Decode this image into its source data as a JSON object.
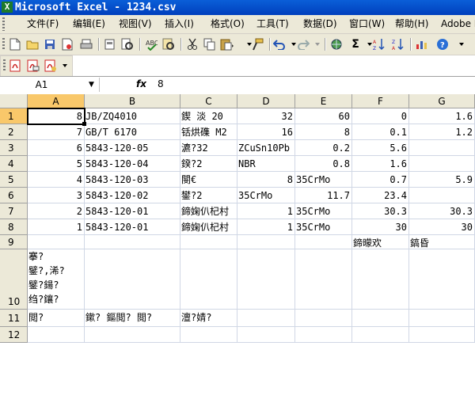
{
  "window": {
    "title": "Microsoft Excel - 1234.csv",
    "app_icon_letter": "X"
  },
  "menu": [
    "文件(F)",
    "编辑(E)",
    "视图(V)",
    "插入(I)",
    "格式(O)",
    "工具(T)",
    "数据(D)",
    "窗口(W)",
    "帮助(H)",
    "Adobe PDF"
  ],
  "toolbar": {
    "buttons": [
      "new-icon",
      "open-icon",
      "save-icon",
      "permission-icon",
      "print-icon",
      "print-preview-icon",
      "spelling-icon",
      "research-icon",
      "cut-icon",
      "copy-icon",
      "paste-icon",
      "format-painter-icon",
      "undo-icon",
      "redo-icon",
      "hyperlink-icon",
      "autosum-icon",
      "sort-ascending-icon",
      "sort-descending-icon",
      "chart-wizard-icon",
      "help-icon"
    ],
    "autosum_glyph": "Σ"
  },
  "pdf_toolbar": {
    "buttons": [
      "convert-to-pdf-icon",
      "convert-and-email-icon",
      "convert-and-review-icon"
    ]
  },
  "formula_bar": {
    "name_box": "A1",
    "fx_label": "fx",
    "value": "8"
  },
  "sheet": {
    "columns": [
      "A",
      "B",
      "C",
      "D",
      "E",
      "F",
      "G"
    ],
    "selected_column": "A",
    "selected_row": "1",
    "rows": [
      {
        "num": "1",
        "cells": [
          "8",
          "JB/ZQ4010",
          "鍥  淡  20",
          "32",
          "60",
          "0",
          "1.6"
        ]
      },
      {
        "num": "2",
        "cells": [
          "7",
          "GB/T 6170",
          "铦烘磼 M2",
          "16",
          "8",
          "0.1",
          "1.2"
        ]
      },
      {
        "num": "3",
        "cells": [
          "6",
          "5843-120-05",
          "瀌?32",
          "ZCuSn10Pb",
          "0.2",
          "5.6",
          ""
        ]
      },
      {
        "num": "4",
        "cells": [
          "5",
          "5843-120-04",
          "鍨?2",
          "NBR",
          "0.8",
          "1.6",
          ""
        ]
      },
      {
        "num": "5",
        "cells": [
          "4",
          "5843-120-03",
          "閿€",
          "8",
          "35CrMo",
          "0.7",
          "5.9"
        ]
      },
      {
        "num": "6",
        "cells": [
          "3",
          "5843-120-02",
          "鐢?2",
          "35CrMo",
          "11.7",
          "23.4",
          ""
        ]
      },
      {
        "num": "7",
        "cells": [
          "2",
          "5843-120-01",
          "鍗婅仈杞村",
          "1",
          "35CrMo",
          "30.3",
          "30.3"
        ]
      },
      {
        "num": "8",
        "cells": [
          "1",
          "5843-120-01",
          "鍗婅仈杞村",
          "1",
          "35CrMo",
          "30",
          "30"
        ]
      },
      {
        "num": "9",
        "cells": [
          "",
          "",
          "",
          "",
          "",
          "鍗曚欢",
          "鎬昏"
        ]
      },
      {
        "num": "10",
        "cells": [
          "搴?\n鐾?,浠?\n鐾?鍚?\n绉?鑲?",
          "",
          "",
          "",
          "",
          "",
          ""
        ]
      },
      {
        "num": "11",
        "cells": [
          "閲?",
          "鏉? 鏂閲? 閲?",
          "澶?婧?",
          "",
          "",
          "",
          ""
        ]
      },
      {
        "num": "12",
        "cells": [
          "",
          "",
          "",
          "",
          "",
          "",
          ""
        ]
      }
    ]
  }
}
